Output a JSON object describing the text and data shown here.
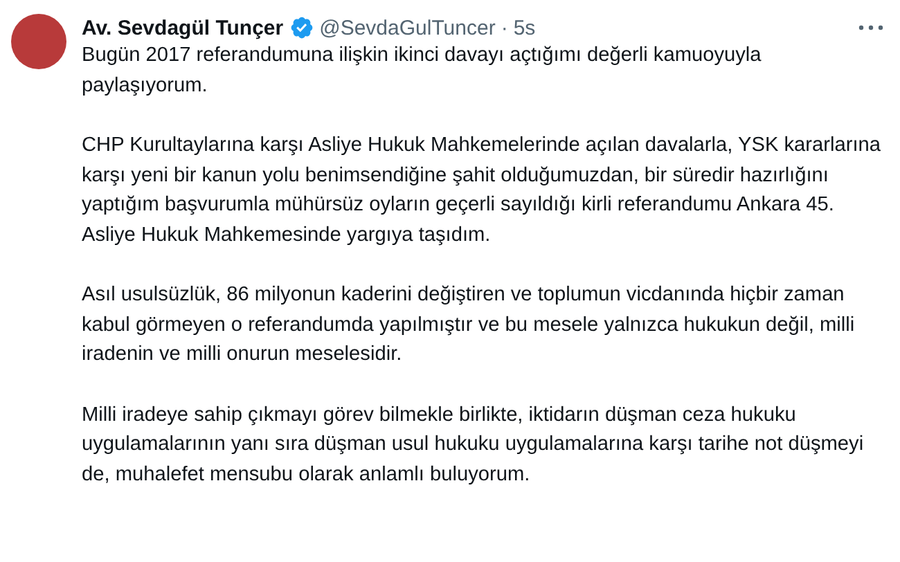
{
  "author": {
    "name": "Av. Sevdagül Tunçer",
    "handle": "@SevdaGulTuncer",
    "separator": "·",
    "time": "5s"
  },
  "paragraphs": [
    "Bugün 2017 referandumuna ilişkin ikinci davayı açtığımı değerli kamuoyuyla paylaşıyorum.",
    "CHP Kurultaylarına karşı Asliye Hukuk Mahkemelerinde açılan davalarla, YSK kararlarına karşı yeni bir kanun yolu benimsendiğine şahit olduğumuzdan, bir süredir hazırlığını yaptığım başvurumla mühürsüz oyların geçerli sayıldığı kirli referandumu Ankara 45. Asliye Hukuk Mahkemesinde yargıya taşıdım.",
    "Asıl usulsüzlük, 86 milyonun kaderini değiştiren ve toplumun vicdanında hiçbir zaman kabul görmeyen o referandumda yapılmıştır ve bu mesele yalnızca hukukun değil, milli iradenin ve milli onurun meselesidir.",
    "Milli iradeye sahip çıkmayı görev bilmekle birlikte, iktidarın düşman ceza hukuku uygulamalarının yanı sıra düşman usul hukuku uygulamalarına karşı tarihe not düşmeyi de, muhalefet mensubu olarak anlamlı buluyorum."
  ]
}
